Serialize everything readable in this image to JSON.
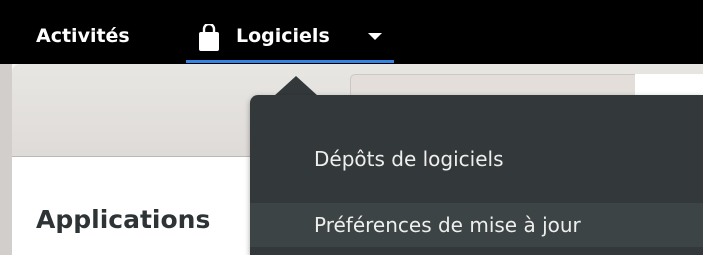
{
  "topbar": {
    "activities_label": "Activités",
    "app_menu": {
      "label": "Logiciels",
      "icon": "shopping-bag-icon",
      "arrow_icon": "chevron-down-icon"
    }
  },
  "app_window": {
    "section_heading": "Applications"
  },
  "menu": {
    "items": [
      {
        "label": "Dépôts de logiciels"
      },
      {
        "label": "Préférences de mise à jour",
        "selected": true
      }
    ]
  },
  "colors": {
    "topbar_bg": "#000000",
    "accent": "#3584e4",
    "popover_bg": "#33393b",
    "popover_item_hover": "#3d4446",
    "menu_text": "#eeeeec"
  }
}
